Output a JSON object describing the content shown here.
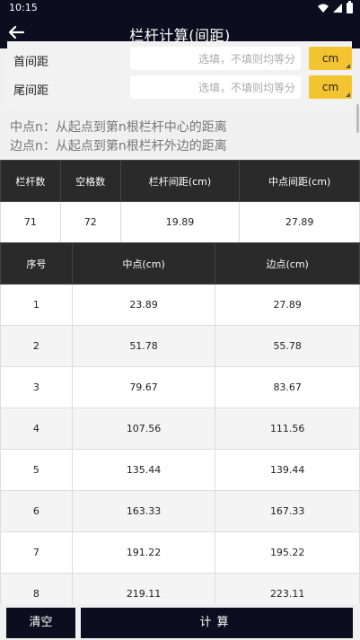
{
  "status": {
    "time": "10:15"
  },
  "appbar": {
    "title": "栏杆计算(间距)"
  },
  "form": {
    "rows": [
      {
        "label": "首间距",
        "placeholder": "选填，不填则均等分",
        "unit": "cm"
      },
      {
        "label": "尾间距",
        "placeholder": "选填，不填则均等分",
        "unit": "cm"
      }
    ]
  },
  "notes": {
    "line1": "中点n：从起点到第n根栏杆中心的距离",
    "line2": "边点n：从起点到第n根栏杆外边的距离"
  },
  "summary": {
    "headers": [
      "栏杆数",
      "空格数",
      "栏杆间距(cm)",
      "中点间距(cm)"
    ],
    "values": [
      "71",
      "72",
      "19.89",
      "27.89"
    ]
  },
  "detail": {
    "headers": [
      "序号",
      "中点(cm)",
      "边点(cm)"
    ],
    "rows": [
      [
        "1",
        "23.89",
        "27.89"
      ],
      [
        "2",
        "51.78",
        "55.78"
      ],
      [
        "3",
        "79.67",
        "83.67"
      ],
      [
        "4",
        "107.56",
        "111.56"
      ],
      [
        "5",
        "135.44",
        "139.44"
      ],
      [
        "6",
        "163.33",
        "167.33"
      ],
      [
        "7",
        "191.22",
        "195.22"
      ],
      [
        "8",
        "219.11",
        "223.11"
      ]
    ]
  },
  "buttons": {
    "clear": "清空",
    "calc": "计算"
  },
  "colors": {
    "bar": "#0d0d1f",
    "unit": "#f4c430",
    "header": "#2a2a2a"
  }
}
